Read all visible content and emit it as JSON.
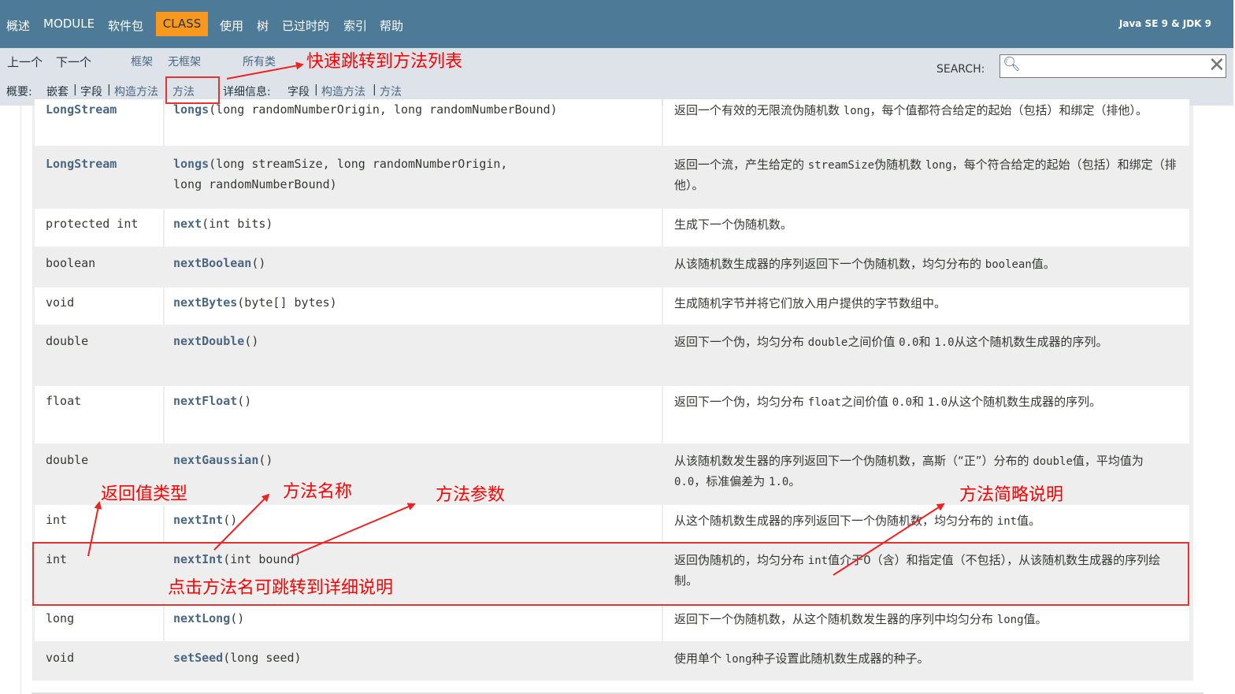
{
  "topnav": {
    "items": [
      "概述",
      "MODULE",
      "软件包",
      "使用",
      "树",
      "已过时的",
      "索引",
      "帮助"
    ],
    "active": "CLASS",
    "version": "Java SE 9 & JDK 9"
  },
  "subnav": {
    "prev": "上一个",
    "next": "下一个",
    "frames": "框架",
    "no_frames": "无框架",
    "all_classes": "所有类",
    "summary_label": "概要:",
    "summary_items": [
      "嵌套",
      "字段",
      "构造方法",
      "方法"
    ],
    "detail_label": "详细信息:",
    "detail_items": [
      "字段",
      "构造方法",
      "方法"
    ],
    "search_label": "SEARCH:",
    "search_value": "",
    "separator": "|"
  },
  "methods": [
    {
      "ret": "LongStream",
      "ret_link": true,
      "name": "longs",
      "params_line1": "(long randomNumberOrigin, long randomNumberBound)",
      "params_line2": "",
      "desc_html": "返回一个有效的无限流伪随机数 <span class='code'>long</span>，每个值都符合给定的起始（包括）和绑定（排他）。"
    },
    {
      "ret": "LongStream",
      "ret_link": true,
      "name": "longs",
      "params_line1": "(long streamSize, long randomNumberOrigin,",
      "params_line2": "long randomNumberBound)",
      "desc_html": "返回一个流，产生给定的 <span class='code'>streamSize</span>伪随机数 <span class='code'>long</span>，每个符合给定的起始（包括）和绑定（排他）。"
    },
    {
      "ret": "protected int",
      "ret_link": false,
      "name": "next",
      "params_line1": "(int bits)",
      "params_line2": "",
      "desc_html": "生成下一个伪随机数。"
    },
    {
      "ret": "boolean",
      "ret_link": false,
      "name": "nextBoolean",
      "params_line1": "()",
      "params_line2": "",
      "desc_html": "从该随机数生成器的序列返回下一个伪随机数，均匀分布的 <span class='code'>boolean</span>值。"
    },
    {
      "ret": "void",
      "ret_link": false,
      "name": "nextBytes",
      "params_line1": "(byte[] bytes)",
      "params_line2": "",
      "desc_html": "生成随机字节并将它们放入用户提供的字节数组中。"
    },
    {
      "ret": "double",
      "ret_link": false,
      "name": "nextDouble",
      "params_line1": "()",
      "params_line2": "",
      "desc_html": "返回下一个伪，均匀分布 <span class='code'>double</span>之间价值 <span class='code'>0.0</span>和 <span class='code'>1.0</span>从这个随机数生成器的序列。"
    },
    {
      "ret": "float",
      "ret_link": false,
      "name": "nextFloat",
      "params_line1": "()",
      "params_line2": "",
      "desc_html": "返回下一个伪，均匀分布 <span class='code'>float</span>之间价值 <span class='code'>0.0</span>和 <span class='code'>1.0</span>从这个随机数生成器的序列。"
    },
    {
      "ret": "double",
      "ret_link": false,
      "name": "nextGaussian",
      "params_line1": "()",
      "params_line2": "",
      "desc_html": "从该随机数发生器的序列返回下一个伪随机数，高斯（“正”）分布的 <span class='code'>double</span>值，平均值为 <span class='code'>0.0</span>，标准偏差为 <span class='code'>1.0</span>。"
    },
    {
      "ret": "int",
      "ret_link": false,
      "name": "nextInt",
      "params_line1": "()",
      "params_line2": "",
      "desc_html": "从这个随机数生成器的序列返回下一个伪随机数，均匀分布的 <span class='code'>int</span>值。"
    },
    {
      "ret": "int",
      "ret_link": false,
      "name": "nextInt",
      "params_line1": "(int bound)",
      "params_line2": "",
      "desc_html": "返回伪随机的，均匀分布 <span class='code'>int</span>值介于0（含）和指定值（不包括），从该随机数生成器的序列绘制。"
    },
    {
      "ret": "long",
      "ret_link": false,
      "name": "nextLong",
      "params_line1": "()",
      "params_line2": "",
      "desc_html": "返回下一个伪随机数，从这个随机数发生器的序列中均匀分布 <span class='code'>long</span>值。"
    },
    {
      "ret": "void",
      "ret_link": false,
      "name": "setSeed",
      "params_line1": "(long seed)",
      "params_line2": "",
      "desc_html": "使用单个 <span class='code'>long</span>种子设置此随机数生成器的种子。"
    }
  ],
  "annotations": {
    "jump_to_methods": "快速跳转到方法列表",
    "return_type": "返回值类型",
    "method_name": "方法名称",
    "method_params": "方法参数",
    "method_summary": "方法简略说明",
    "click_detail": "点击方法名可跳转到详细说明"
  },
  "colors": {
    "topnav_bg": "#4d7a97",
    "active_tab": "#f8981d",
    "subnav_bg": "#dee3e9",
    "link": "#4a6782",
    "annotation": "#ff0000"
  }
}
